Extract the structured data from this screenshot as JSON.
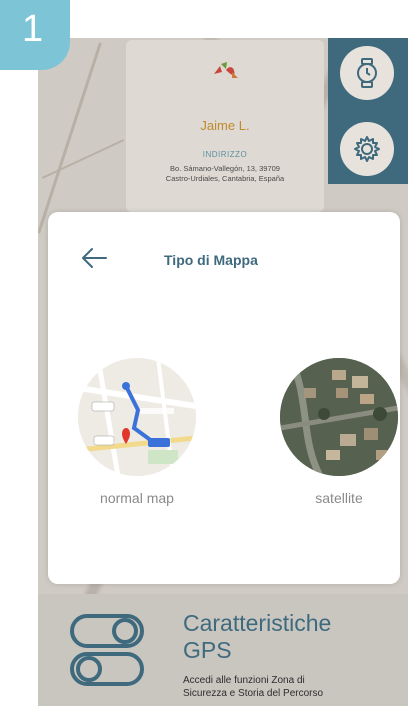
{
  "step": {
    "number": "1"
  },
  "profile": {
    "name": "Jaime L.",
    "address_label": "INDIRIZZO",
    "address_line1": "Bo. Sámano-Vallegón, 13, 39709",
    "address_line2": "Castro-Urdiales, Cantabria, España"
  },
  "icons": {
    "watch": "watch-icon",
    "settings": "gear-icon",
    "back": "arrow-left-icon",
    "toggle": "toggle-icon"
  },
  "modal": {
    "title": "Tipo di Mappa",
    "options": [
      {
        "label": "normal map"
      },
      {
        "label": "satellite"
      }
    ]
  },
  "feature": {
    "title_line1": "Caratteristiche",
    "title_line2": "GPS",
    "desc_line1": "Accedi alle funzioni Zona di",
    "desc_line2": "Sicurezza e Storia del Percorso"
  },
  "colors": {
    "accent": "#3f6a7e",
    "badge": "#7cc4d6",
    "name": "#c08a2e"
  }
}
